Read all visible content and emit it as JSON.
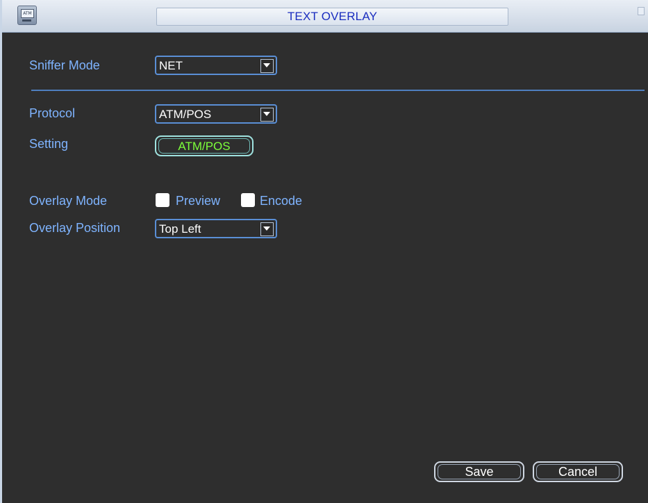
{
  "window": {
    "title": "TEXT OVERLAY",
    "app_icon_text": "ATM"
  },
  "sniffer": {
    "label": "Sniffer Mode",
    "value": "NET"
  },
  "protocol": {
    "label": "Protocol",
    "value": "ATM/POS"
  },
  "setting": {
    "label": "Setting",
    "button_label": "ATM/POS"
  },
  "overlay_mode": {
    "label": "Overlay Mode",
    "options": [
      {
        "label": "Preview",
        "checked": false
      },
      {
        "label": "Encode",
        "checked": false
      }
    ]
  },
  "overlay_position": {
    "label": "Overlay Position",
    "value": "Top Left"
  },
  "actions": {
    "save_label": "Save",
    "cancel_label": "Cancel"
  },
  "colors": {
    "accent_label": "#7fb4ff",
    "title_text": "#1a2dbf",
    "setting_button_text": "#7cff3a",
    "background": "#2e2e2e"
  },
  "icons": {
    "app_icon": "atm-terminal-icon",
    "dropdown_arrow": "chevron-down-icon",
    "close": "close-icon"
  }
}
